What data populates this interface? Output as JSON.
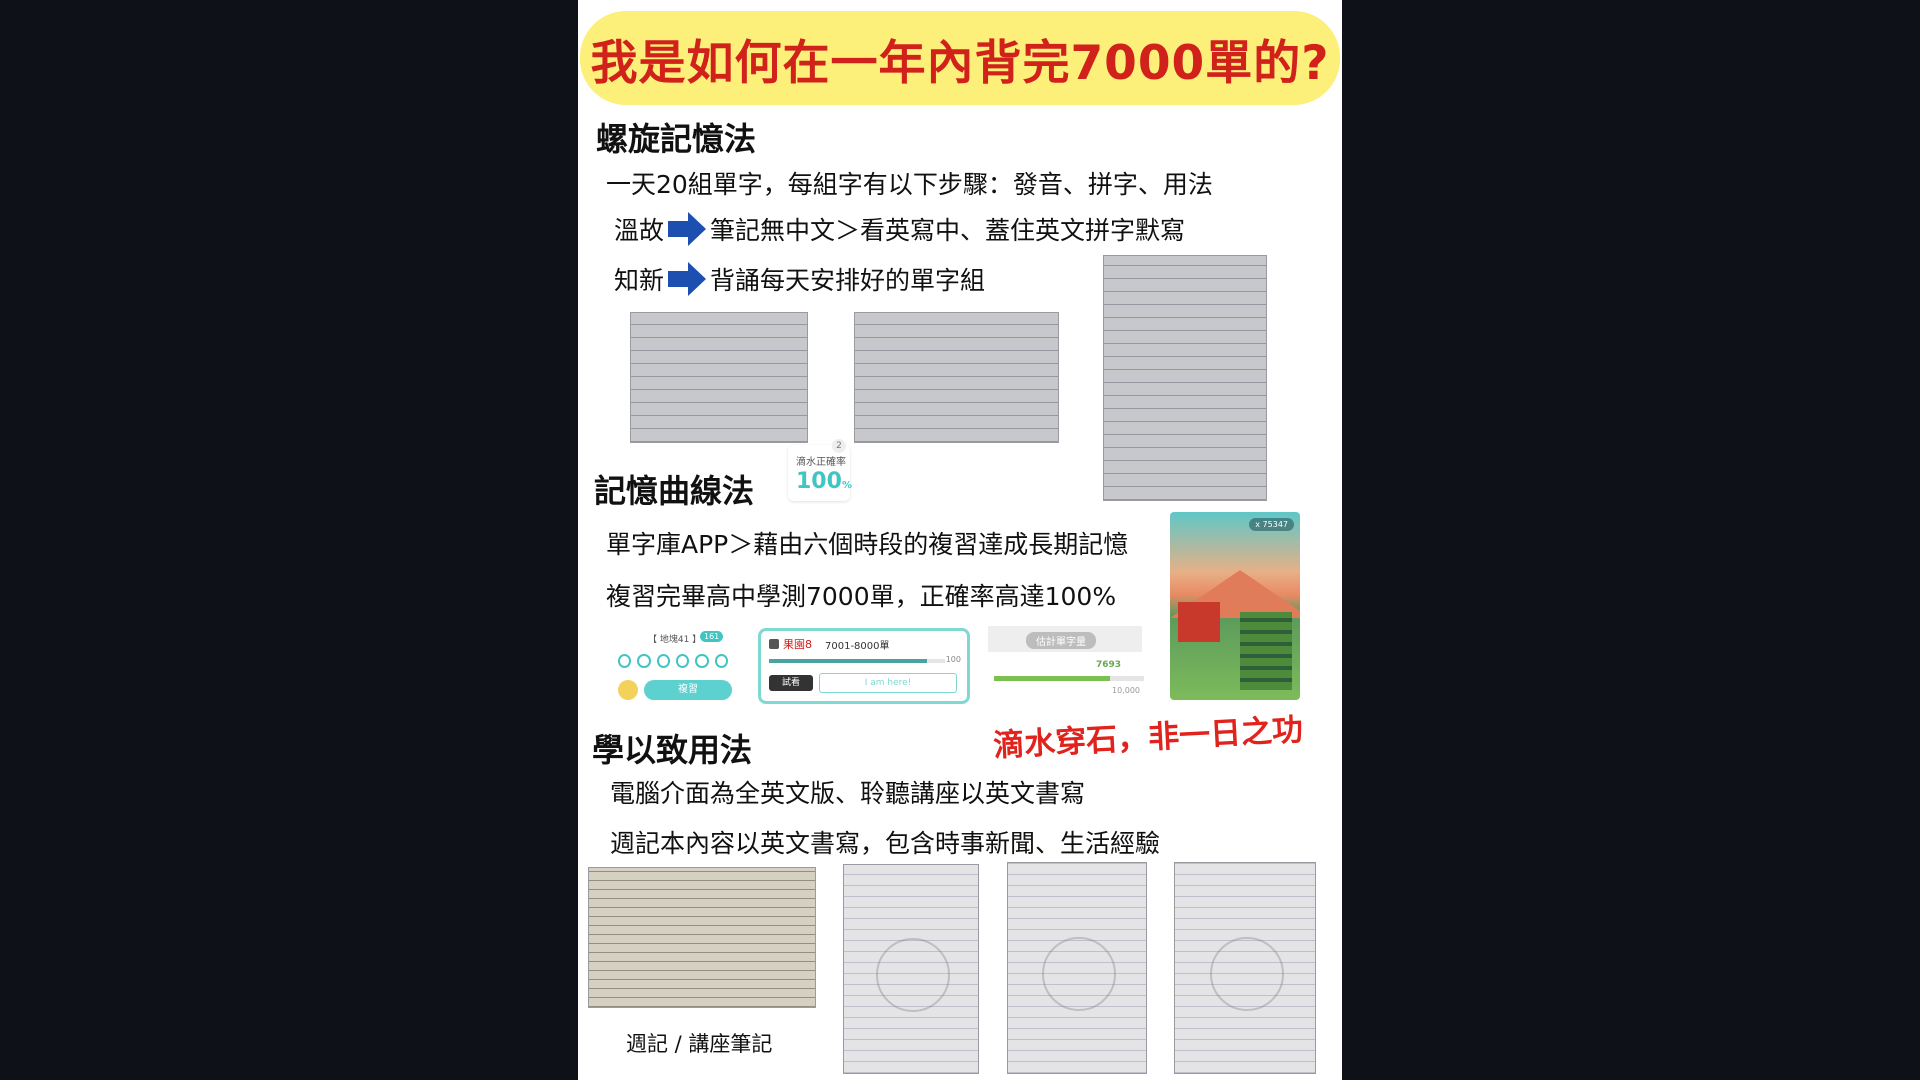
{
  "title": "我是如何在一年內背完7000單的?",
  "sections": {
    "spiral": {
      "title": "螺旋記憶法",
      "line1": "一天20組單字，每組字有以下步驟：發音、拼字、用法",
      "review_label": "溫故",
      "review_text": "筆記無中文＞看英寫中、蓋住英文拼字默寫",
      "new_label": "知新",
      "new_text": "背誦每天安排好的單字組"
    },
    "curve": {
      "title": "記憶曲線法",
      "line1": "單字庫APP＞藉由六個時段的複習達成長期記憶",
      "line2": "複習完畢高中學測7000單，正確率高達100%"
    },
    "apply": {
      "title": "學以致用法",
      "line1": "電腦介面為全英文版、聆聽講座以英文書寫",
      "line2": "週記本內容以英文書寫，包含時事新聞、生活經驗"
    }
  },
  "slogan": "滴水穿石，非一日之功",
  "caption": "週記 / 講座筆記",
  "widgets": {
    "accuracy": {
      "label": "滴水正確率",
      "value": "100",
      "unit": "%",
      "badge": "2"
    },
    "map": {
      "label": "【 地塊41 】",
      "badge": "161",
      "review_button": "複習"
    },
    "progress": {
      "group": "果園8",
      "range": "7001-8000單",
      "max": "100",
      "try_button": "試看",
      "placeholder": "I am here!"
    },
    "estimate": {
      "label": "估計單字量",
      "value": "7693",
      "max": "10,000",
      "fill_fraction": 0.77
    },
    "game": {
      "coins": "x 75347"
    }
  },
  "colors": {
    "title": "#d0211b",
    "banner": "#fcef7a",
    "arrow": "#1c4fb0",
    "accent": "#41c5c2",
    "slogan": "#e0231d"
  }
}
